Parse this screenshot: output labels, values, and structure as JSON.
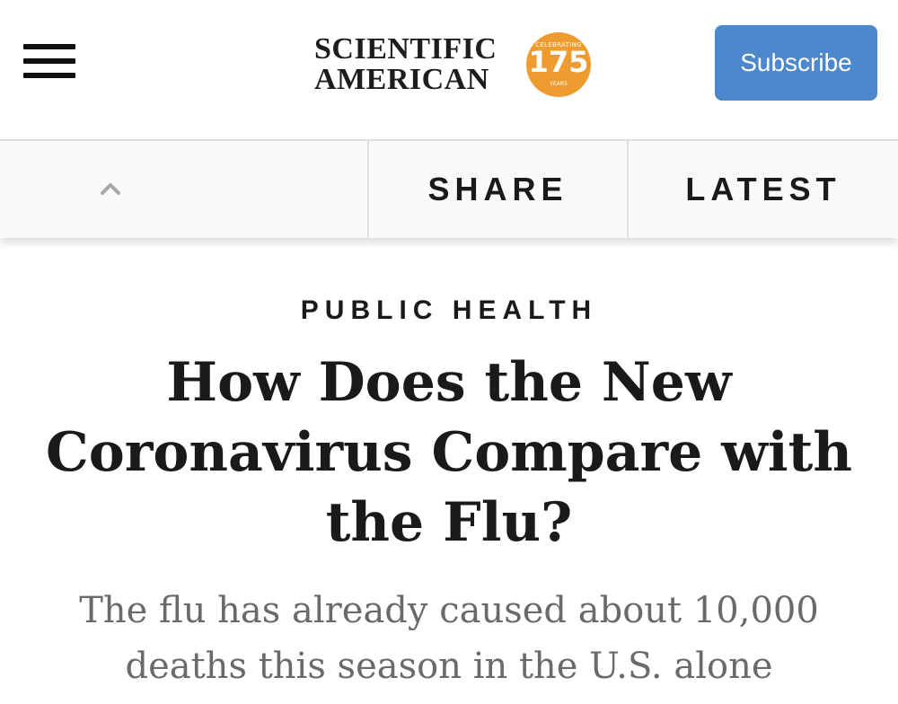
{
  "header": {
    "menu_icon": "hamburger-menu-icon",
    "logo": {
      "line1": "SCIENTIFIC",
      "line2": "AMERICAN",
      "badge_top": "CELEBRATING",
      "badge_number": "175",
      "badge_bottom": "YEARS",
      "badge_color": "#ee9c2f"
    },
    "subscribe_label": "Subscribe",
    "subscribe_color": "#4d88cc"
  },
  "subnav": {
    "up_icon": "chevron-up-icon",
    "share_label": "SHARE",
    "latest_label": "LATEST"
  },
  "article": {
    "kicker": "PUBLIC HEALTH",
    "headline": "How Does the New Coronavirus Compare with the Flu?",
    "dek": "The flu has already caused about 10,000 deaths this season in the U.S. alone"
  }
}
